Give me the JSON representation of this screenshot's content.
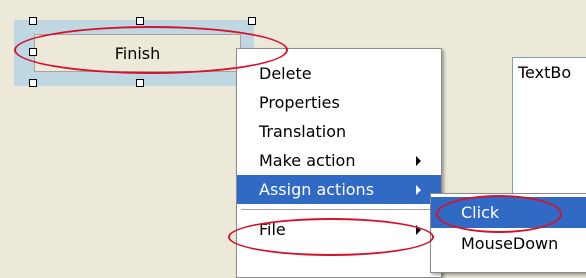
{
  "designer": {
    "selected_button_label": "Finish",
    "textbox_label": "TextBo"
  },
  "context_menu": {
    "items": [
      {
        "label": "Delete"
      },
      {
        "label": "Properties"
      },
      {
        "label": "Translation"
      },
      {
        "label": "Make action",
        "has_submenu": true
      },
      {
        "label": "Assign actions",
        "has_submenu": true,
        "highlighted": true
      },
      {
        "label": "File",
        "has_submenu": true
      }
    ]
  },
  "submenu": {
    "items": [
      {
        "label": "Click",
        "highlighted": true
      },
      {
        "label": "MouseDown"
      }
    ]
  },
  "colors": {
    "background": "#ece9d8",
    "selection_frame": "#bfd7e3",
    "highlight": "#316ac5",
    "annotation": "#d6112e"
  }
}
